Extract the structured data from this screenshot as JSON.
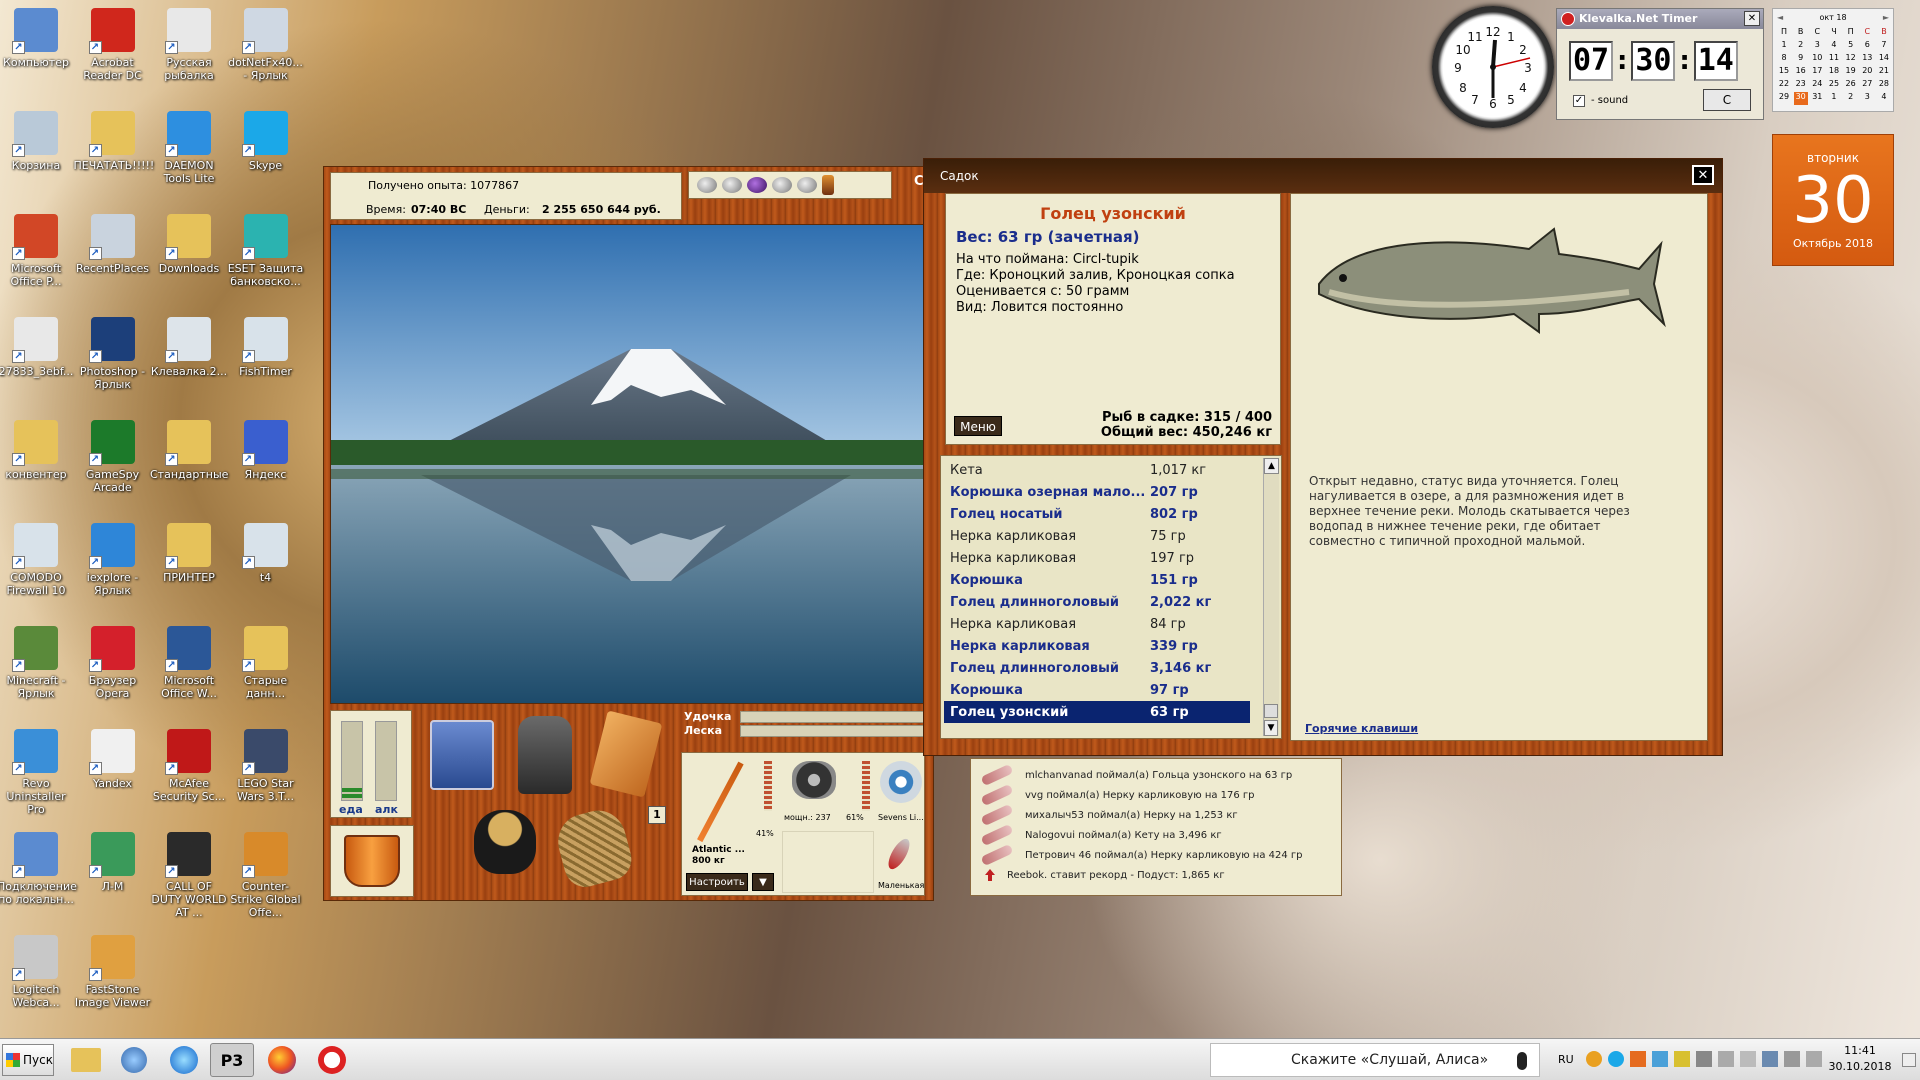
{
  "desktop_icons": [
    {
      "label": "Компьютер",
      "icon": "computer-icon",
      "color": "#5b8bd0",
      "col": 0,
      "row": 0
    },
    {
      "label": "Acrobat Reader DC",
      "icon": "acrobat-icon",
      "color": "#d0271c",
      "col": 1,
      "row": 0
    },
    {
      "label": "Русская рыбалка",
      "icon": "russian-fishing-icon",
      "color": "#e8e8e8",
      "col": 2,
      "row": 0
    },
    {
      "label": "dotNetFx40... - Ярлык",
      "icon": "dotnet-icon",
      "color": "#cfd8e3",
      "col": 3,
      "row": 0
    },
    {
      "label": "Корзина",
      "icon": "recycle-bin-icon",
      "color": "#b9c9d8",
      "col": 0,
      "row": 1
    },
    {
      "label": "ПЕЧАТАТЬ!!!!!",
      "icon": "folder-icon",
      "color": "#e6c25a",
      "col": 1,
      "row": 1
    },
    {
      "label": "DAEMON Tools Lite",
      "icon": "daemon-tools-icon",
      "color": "#2d8fe0",
      "col": 2,
      "row": 1
    },
    {
      "label": "Skype",
      "icon": "skype-icon",
      "color": "#1ba8e8",
      "col": 3,
      "row": 1
    },
    {
      "label": "Microsoft Office P...",
      "icon": "powerpoint-icon",
      "color": "#d24726",
      "col": 0,
      "row": 2
    },
    {
      "label": "RecentPlaces",
      "icon": "recent-places-icon",
      "color": "#c9d3de",
      "col": 1,
      "row": 2
    },
    {
      "label": "Downloads",
      "icon": "folder-icon",
      "color": "#e6c25a",
      "col": 2,
      "row": 2
    },
    {
      "label": "ESET Защита банковско...",
      "icon": "eset-icon",
      "color": "#2bb3b0",
      "col": 3,
      "row": 2
    },
    {
      "label": "27833_3ebf...",
      "icon": "pdf-icon",
      "color": "#e8e8e8",
      "col": 0,
      "row": 3
    },
    {
      "label": "Photoshop - Ярлык",
      "icon": "photoshop-icon",
      "color": "#1c3f7a",
      "col": 1,
      "row": 3
    },
    {
      "label": "Клевалка.2...",
      "icon": "document-icon",
      "color": "#dde4ea",
      "col": 2,
      "row": 3
    },
    {
      "label": "FishTimer",
      "icon": "window-icon",
      "color": "#d8e2ea",
      "col": 3,
      "row": 3
    },
    {
      "label": "конвентер",
      "icon": "folder-icon",
      "color": "#e6c25a",
      "col": 0,
      "row": 4
    },
    {
      "label": "GameSpy Arcade",
      "icon": "gamespy-icon",
      "color": "#1c7a2a",
      "col": 1,
      "row": 4
    },
    {
      "label": "Стандартные",
      "icon": "folder-icon",
      "color": "#e6c25a",
      "col": 2,
      "row": 4
    },
    {
      "label": "Яндекс",
      "icon": "yandex-browser-icon",
      "color": "#3a5fcf",
      "col": 3,
      "row": 4
    },
    {
      "label": "COMODO Firewall 10",
      "icon": "comodo-icon",
      "color": "#d8e2ea",
      "col": 0,
      "row": 5
    },
    {
      "label": "iexplore - Ярлык",
      "icon": "ie-icon",
      "color": "#2e86d8",
      "col": 1,
      "row": 5
    },
    {
      "label": "ПРИНТЕР",
      "icon": "folder-icon",
      "color": "#e6c25a",
      "col": 2,
      "row": 5
    },
    {
      "label": "t4",
      "icon": "window-icon",
      "color": "#d8e2ea",
      "col": 3,
      "row": 5
    },
    {
      "label": "Minecraft - Ярлык",
      "icon": "minecraft-icon",
      "color": "#5a8a3a",
      "col": 0,
      "row": 6
    },
    {
      "label": "Браузер Opera",
      "icon": "opera-icon",
      "color": "#d4202b",
      "col": 1,
      "row": 6
    },
    {
      "label": "Microsoft Office W...",
      "icon": "word-icon",
      "color": "#2b5797",
      "col": 2,
      "row": 6
    },
    {
      "label": "Старые данн...",
      "icon": "folder-icon",
      "color": "#e6c25a",
      "col": 3,
      "row": 6
    },
    {
      "label": "Revo Uninstaller Pro",
      "icon": "revo-icon",
      "color": "#3a8fd8",
      "col": 0,
      "row": 7
    },
    {
      "label": "Yandex",
      "icon": "yandex-icon",
      "color": "#f0f0f0",
      "col": 1,
      "row": 7
    },
    {
      "label": "McAfee Security Sc...",
      "icon": "mcafee-icon",
      "color": "#c01818",
      "col": 2,
      "row": 7
    },
    {
      "label": "LEGO Star Wars 3.T...",
      "icon": "lego-starwars-icon",
      "color": "#3a4a6a",
      "col": 3,
      "row": 7
    },
    {
      "label": "Подключение по локальн...",
      "icon": "network-icon",
      "color": "#5b8bd0",
      "col": 0,
      "row": 8
    },
    {
      "label": "Л-М",
      "icon": "globe-icon",
      "color": "#3a9a5a",
      "col": 1,
      "row": 8
    },
    {
      "label": "CALL OF DUTY WORLD AT ...",
      "icon": "cod-icon",
      "color": "#2a2a2a",
      "col": 2,
      "row": 8
    },
    {
      "label": "Counter-Strike Global Offe...",
      "icon": "csgo-icon",
      "color": "#d88a2a",
      "col": 3,
      "row": 8
    },
    {
      "label": "Logitech Webca...",
      "icon": "webcam-icon",
      "color": "#c8c8c8",
      "col": 0,
      "row": 9
    },
    {
      "label": "FastStone Image Viewer",
      "icon": "faststone-icon",
      "color": "#e0a040",
      "col": 1,
      "row": 9
    }
  ],
  "game": {
    "exp_label": "Получено опыта: 1077867",
    "time_label": "Время:",
    "time_value": "07:40 ВС",
    "money_label": "Деньги:",
    "money_value": "2 255 650 644 руб.",
    "food_label": "еда",
    "alc_label": "алк",
    "food_level": 0.15,
    "alc_level": 0.0,
    "rod_label": "Удочка",
    "line_label": "Леска",
    "slot_count": "1",
    "rod_name": "Atlantic ...",
    "rod_weight": "800 кг",
    "rod_pct": "41%",
    "reel_power": "мощн.: 237",
    "reel_pct": "61%",
    "line_name": "Sevens Li...",
    "lure_name": "Маленькая",
    "setup_button": "Настроить",
    "dropdown_glyph": "▼",
    "tab_edge": "С"
  },
  "log": [
    "mlchanvanad поймал(а) Гольца узонского на 63 гр",
    "vvg поймал(а) Нерку карликовую на 176 гр",
    "михалыч53 поймал(а) Нерку на 1,253 кг",
    "Nalogovui поймал(а) Кету на 3,496 кг",
    "Петрович 46 поймал(а) Нерку карликовую на 424 гр",
    "Reebok. ставит рекорд - Подуст: 1,865 кг"
  ],
  "sadok": {
    "title": "Садок",
    "close": "✕",
    "fish_name": "Голец узонский",
    "weight": "Вес: 63 гр (зачетная)",
    "caught_on": "На что поймана: Circl-tupik",
    "where": "Где: Кроноцкий залив, Кроноцкая сопка",
    "valued": "Оценивается с: 50 грамм",
    "kind": "Вид: Ловится постоянно",
    "menu_button": "Меню",
    "count": "Рыб в садке: 315 / 400",
    "total_weight": "Общий вес: 450,246 кг",
    "description": "Открыт недавно, статус вида уточняется. Голец нагуливается в озере, а для размножения идет в верхнее течение реки. Молодь скатывается через водопад в нижнее течение реки, где обитает совместно с типичной проходной мальмой.",
    "hotkeys": "Горячие клавиши",
    "fish_list": [
      {
        "name": "Кета",
        "weight": "1,017 кг",
        "style": "norm"
      },
      {
        "name": "Корюшка озерная мало...",
        "weight": "207 гр",
        "style": "hl"
      },
      {
        "name": "Голец носатый",
        "weight": "802 гр",
        "style": "hl"
      },
      {
        "name": "Нерка карликовая",
        "weight": "75 гр",
        "style": "norm"
      },
      {
        "name": "Нерка карликовая",
        "weight": "197 гр",
        "style": "norm"
      },
      {
        "name": "Корюшка",
        "weight": "151 гр",
        "style": "hl"
      },
      {
        "name": "Голец длинноголовый",
        "weight": "2,022 кг",
        "style": "hl"
      },
      {
        "name": "Нерка карликовая",
        "weight": "84 гр",
        "style": "norm"
      },
      {
        "name": "Нерка карликовая",
        "weight": "339 гр",
        "style": "hl"
      },
      {
        "name": "Голец длинноголовый",
        "weight": "3,146 кг",
        "style": "hl"
      },
      {
        "name": "Корюшка",
        "weight": "97 гр",
        "style": "hl"
      },
      {
        "name": "Голец узонский",
        "weight": "63 гр",
        "style": "sel"
      }
    ]
  },
  "timer": {
    "title": "Klevalka.Net Timer",
    "close": "✕",
    "h": "07",
    "m": "30",
    "s": "14",
    "sound_label": "- sound",
    "reset": "C"
  },
  "calendar": {
    "month_label": "окт 18",
    "prev": "◄",
    "next": "►",
    "dow": [
      "П",
      "В",
      "С",
      "Ч",
      "П",
      "С",
      "В"
    ],
    "days": [
      [
        "1",
        "2",
        "3",
        "4",
        "5",
        "6",
        "7"
      ],
      [
        "8",
        "9",
        "10",
        "11",
        "12",
        "13",
        "14"
      ],
      [
        "15",
        "16",
        "17",
        "18",
        "19",
        "20",
        "21"
      ],
      [
        "22",
        "23",
        "24",
        "25",
        "26",
        "27",
        "28"
      ],
      [
        "29",
        "30",
        "31",
        "1",
        "2",
        "3",
        "4"
      ]
    ],
    "today": "30",
    "weekday": "вторник",
    "day": "30",
    "month_year": "Октябрь 2018"
  },
  "taskbar": {
    "start": "Пуск",
    "alice": "Скажите «Слушай, Алиса»",
    "lang": "RU",
    "time": "11:41",
    "date": "30.10.2018"
  },
  "colors": {
    "wood": "#b0501a",
    "paper": "#efebd1",
    "list_bg": "#e9e5c6",
    "selected": "#0a2470",
    "highlight": "#1a2d8c",
    "timer_digits": "#111111",
    "calendar_orange": "#e86a1c"
  }
}
